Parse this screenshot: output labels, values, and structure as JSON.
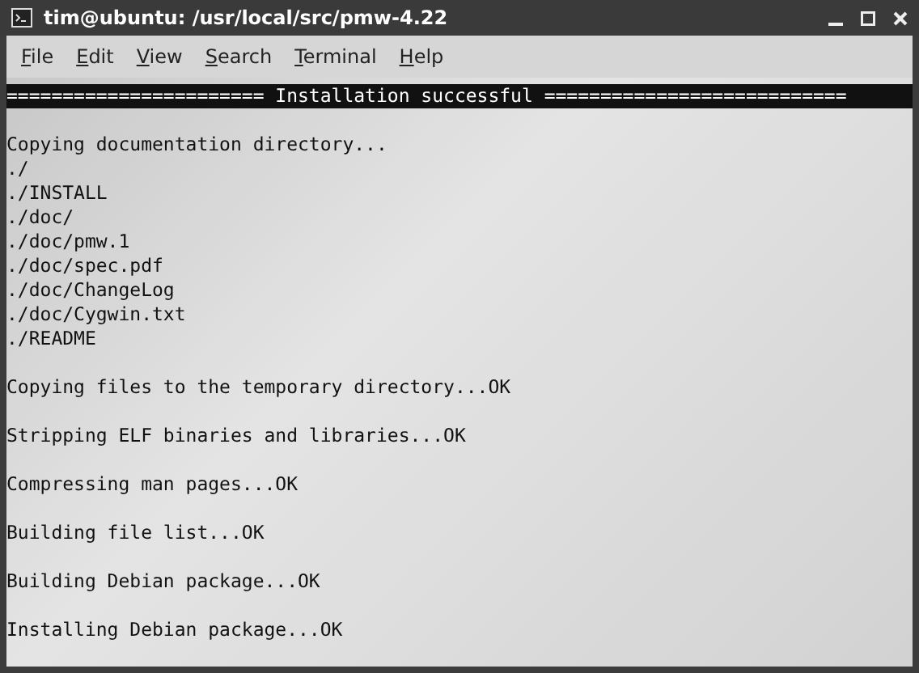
{
  "window": {
    "title": "tim@ubuntu: /usr/local/src/pmw-4.22"
  },
  "menu": [
    "File",
    "Edit",
    "View",
    "Search",
    "Terminal",
    "Help"
  ],
  "terminal": {
    "banner": "======================= Installation successful ===========================",
    "blocks": [
      [
        "Copying documentation directory...",
        "./",
        "./INSTALL",
        "./doc/",
        "./doc/pmw.1",
        "./doc/spec.pdf",
        "./doc/ChangeLog",
        "./doc/Cygwin.txt",
        "./README"
      ],
      [
        "Copying files to the temporary directory...OK"
      ],
      [
        "Stripping ELF binaries and libraries...OK"
      ],
      [
        "Compressing man pages...OK"
      ],
      [
        "Building file list...OK"
      ],
      [
        "Building Debian package...OK"
      ],
      [
        "Installing Debian package...OK"
      ]
    ]
  }
}
